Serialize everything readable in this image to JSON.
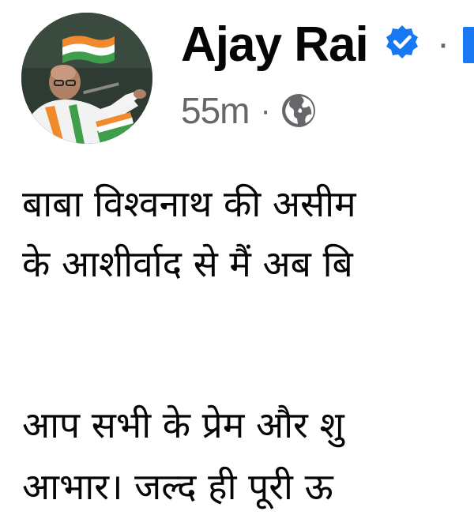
{
  "post": {
    "author": {
      "name": "Ajay Rai",
      "verified": true,
      "avatar_description": "speaker-photo"
    },
    "meta": {
      "time": "55m",
      "separator": "·",
      "audience_icon": "globe-icon"
    },
    "name_separator": "·",
    "body_lines": [
      "बाबा विश्वनाथ की असीम",
      "के आशीर्वाद से मैं अब बि",
      "आप सभी के प्रेम और शु",
      "आभार। जल्द ही पूरी ऊ"
    ]
  },
  "colors": {
    "verified_badge": "#1877f2",
    "secondary_text": "#65676b",
    "primary_text": "#050505",
    "background": "#ffffff"
  }
}
